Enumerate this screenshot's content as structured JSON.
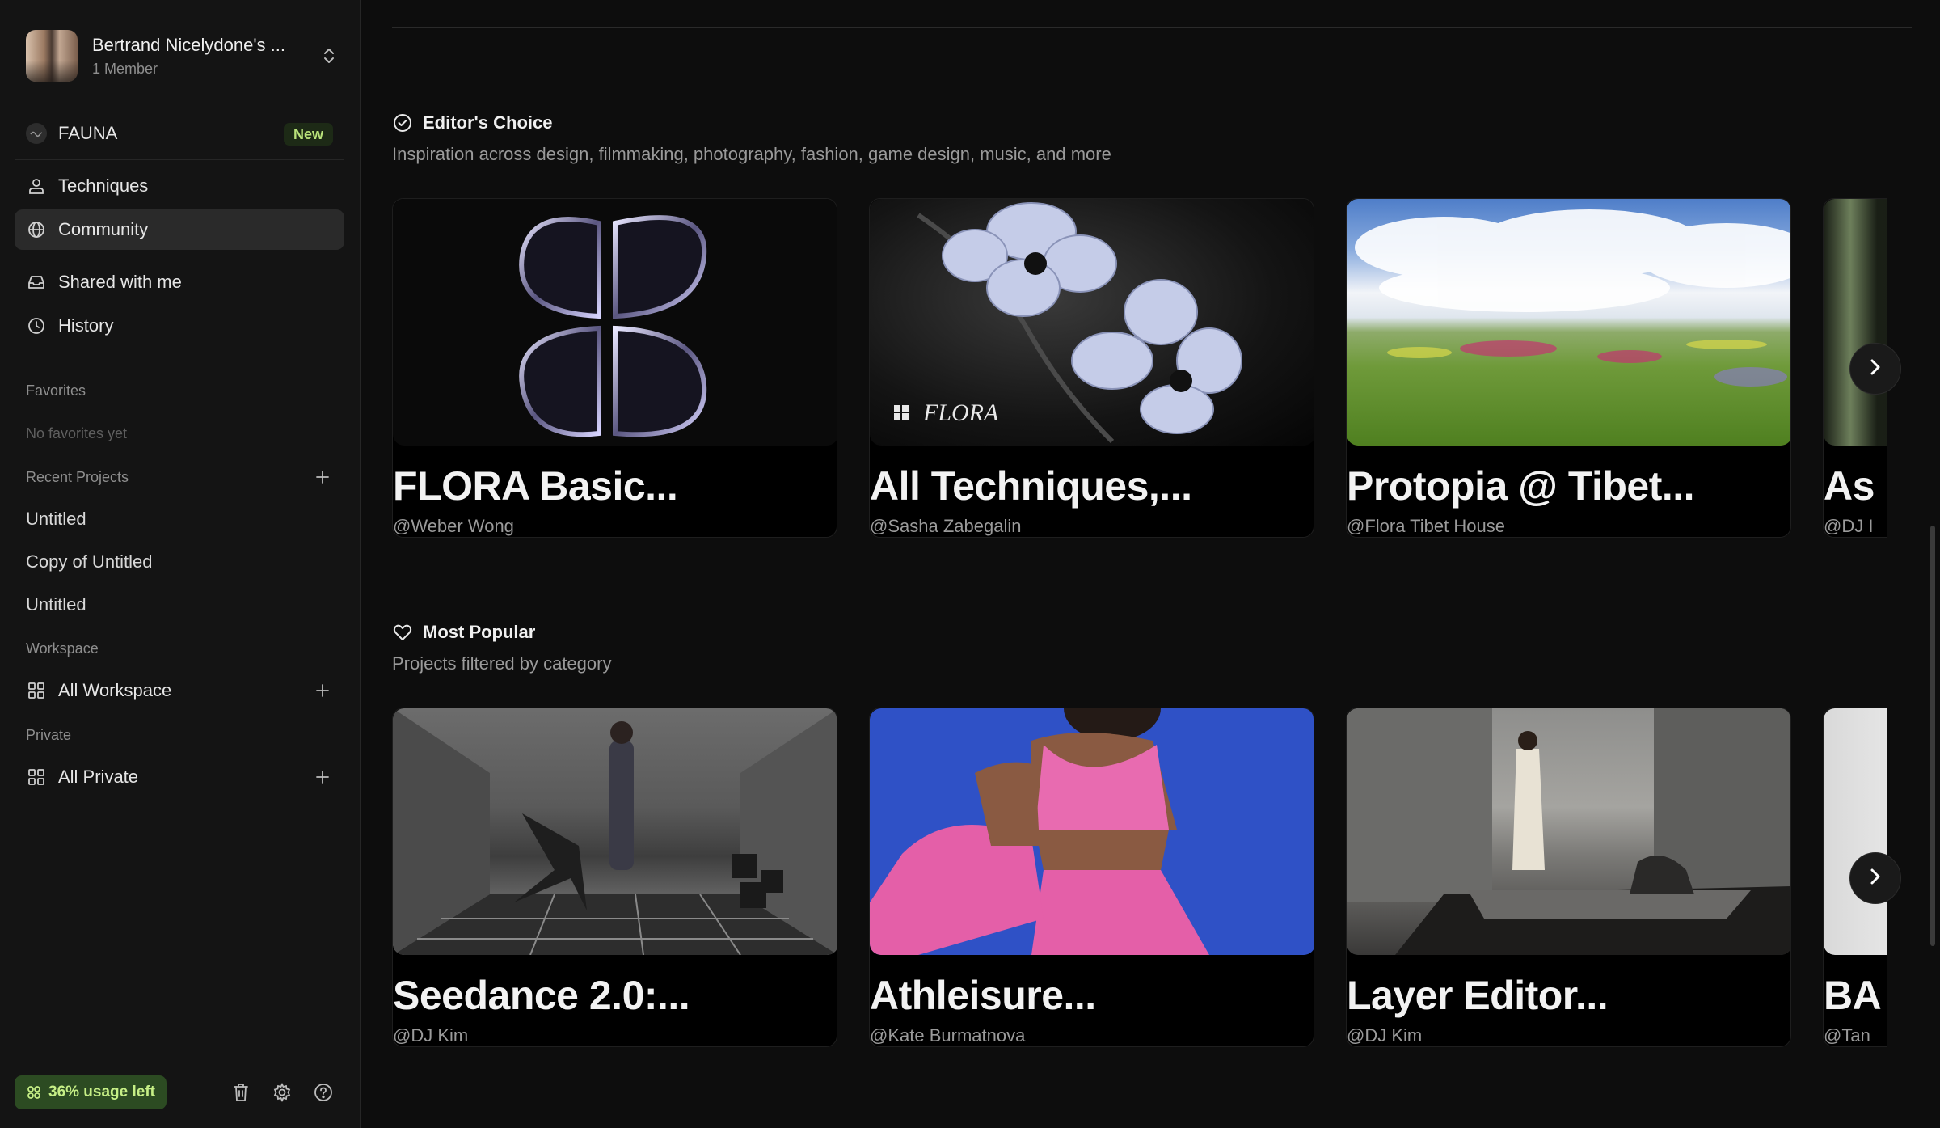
{
  "workspace": {
    "name": "Bertrand Nicelydone's ...",
    "members": "1 Member"
  },
  "nav": {
    "fauna": {
      "label": "FAUNA",
      "badge": "New"
    },
    "techniques": "Techniques",
    "community": "Community",
    "shared": "Shared with me",
    "history": "History"
  },
  "favorites": {
    "label": "Favorites",
    "empty": "No favorites yet"
  },
  "recent": {
    "label": "Recent Projects",
    "items": [
      "Untitled",
      "Copy of Untitled",
      "Untitled"
    ]
  },
  "workspace_section": {
    "label": "Workspace",
    "item": "All Workspace"
  },
  "private_section": {
    "label": "Private",
    "item": "All Private"
  },
  "footer": {
    "usage": "36% usage left"
  },
  "editors_choice": {
    "title": "Editor's Choice",
    "subtitle": "Inspiration across design, filmmaking, photography, fashion, game design, music, and more",
    "cards": [
      {
        "title": "FLORA Basic...",
        "author": "@Weber Wong"
      },
      {
        "title": "All Techniques,...",
        "author": "@Sasha Zabegalin",
        "watermark": "FLORA"
      },
      {
        "title": "Protopia @ Tibet...",
        "author": "@Flora Tibet House"
      },
      {
        "title": "As",
        "author": "@DJ I"
      }
    ]
  },
  "most_popular": {
    "title": "Most Popular",
    "subtitle": "Projects filtered by category",
    "cards": [
      {
        "title": "Seedance 2.0:...",
        "author": "@DJ Kim"
      },
      {
        "title": "Athleisure...",
        "author": "@Kate Burmatnova"
      },
      {
        "title": "Layer Editor...",
        "author": "@DJ Kim"
      },
      {
        "title": "BA",
        "author": "@Tan"
      }
    ]
  },
  "colors": {
    "accent_green": "#c6ef86",
    "active_bg": "#2a2a2a",
    "background": "#0d0d0d"
  }
}
